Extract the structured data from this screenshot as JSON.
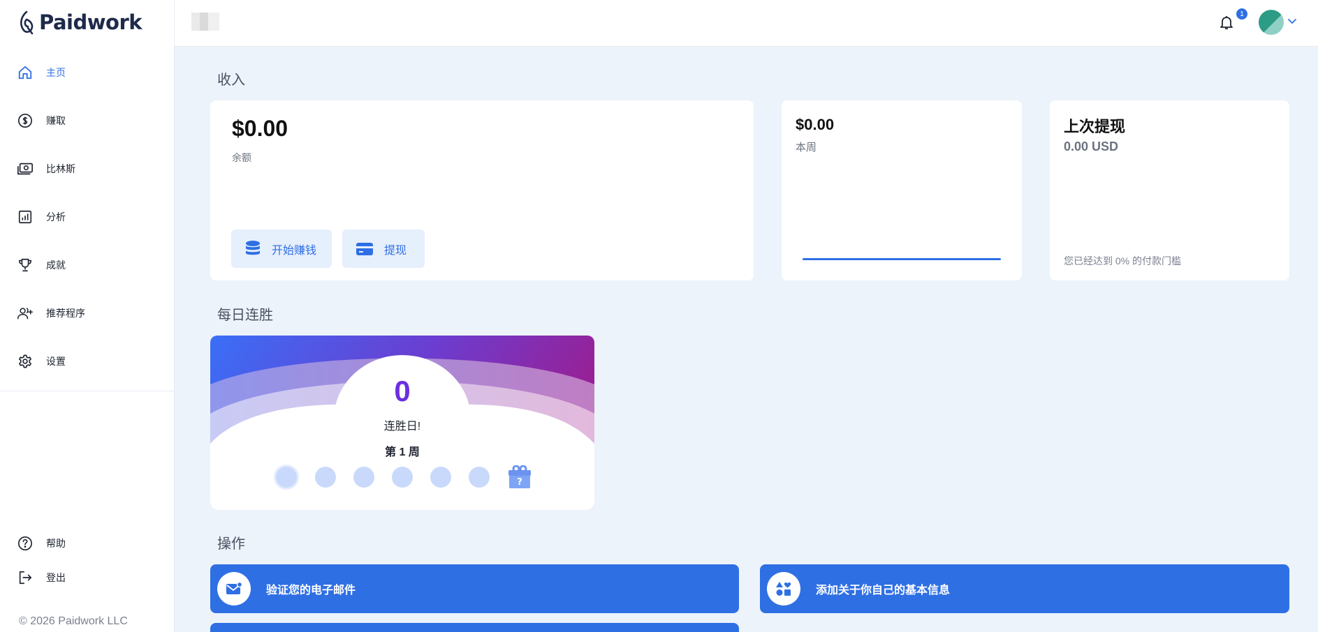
{
  "brand": {
    "name": "Paidwork"
  },
  "sidebar": {
    "items": [
      {
        "label": "主页",
        "icon": "home-icon",
        "active": true
      },
      {
        "label": "赚取",
        "icon": "dollar-circle-icon"
      },
      {
        "label": "比林斯",
        "icon": "banknote-icon"
      },
      {
        "label": "分析",
        "icon": "analytics-icon"
      },
      {
        "label": "成就",
        "icon": "trophy-icon"
      },
      {
        "label": "推荐程序",
        "icon": "add-user-icon"
      },
      {
        "label": "设置",
        "icon": "gear-icon"
      }
    ],
    "bottom_items": [
      {
        "label": "帮助",
        "icon": "help-icon"
      },
      {
        "label": "登出",
        "icon": "logout-icon"
      }
    ],
    "copyright": "© 2026 Paidwork LLC"
  },
  "header": {
    "notification_count": "1"
  },
  "income": {
    "section_title": "收入",
    "balance": {
      "amount": "$0.00",
      "label": "余额"
    },
    "buttons": {
      "start_earning": "开始赚钱",
      "withdraw": "提现"
    },
    "this_week": {
      "amount": "$0.00",
      "label": "本周"
    },
    "last_withdrawal": {
      "title": "上次提现",
      "amount": "0.00 USD",
      "note": "您已经达到 0% 的付款门槛"
    }
  },
  "streak": {
    "section_title": "每日连胜",
    "count": "0",
    "label": "连胜日!",
    "week": "第 1 周",
    "gift_mark": "?"
  },
  "actions": {
    "section_title": "操作",
    "items": [
      {
        "label": "验证您的电子邮件",
        "icon": "mail-icon"
      },
      {
        "label": "添加关于你自己的基本信息",
        "icon": "shapes-icon"
      }
    ]
  },
  "colors": {
    "accent": "#2f6fe4",
    "streak_number": "#6c2ee0",
    "background": "#ecf3fb"
  }
}
